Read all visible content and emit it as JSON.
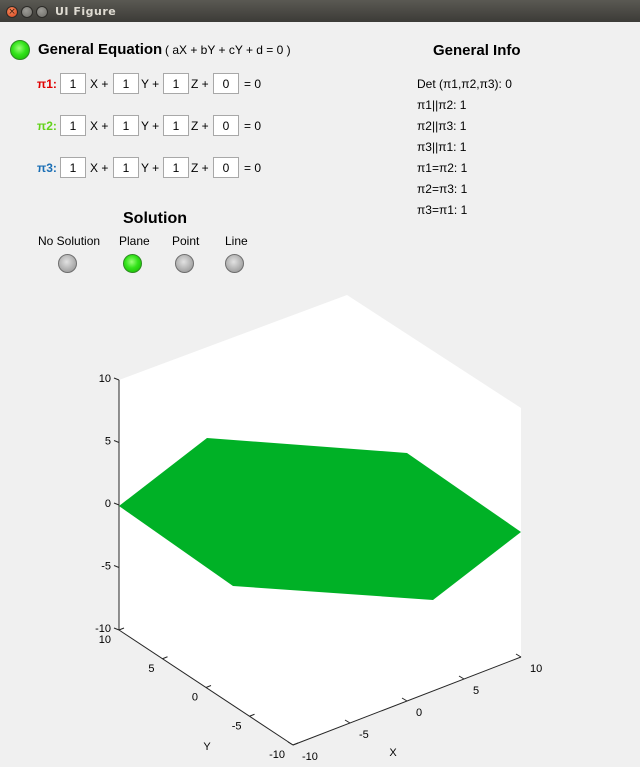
{
  "window": {
    "title": "UI Figure"
  },
  "equation": {
    "heading": "General Equation",
    "form": "( aX + bY + cY + d = 0 )",
    "rows": [
      {
        "label": "π1:",
        "color": "#e00000",
        "a": "1",
        "b": "1",
        "c": "1",
        "d": "0"
      },
      {
        "label": "π2:",
        "color": "#63d21b",
        "a": "1",
        "b": "1",
        "c": "1",
        "d": "0"
      },
      {
        "label": "π3:",
        "color": "#1b6fb5",
        "a": "1",
        "b": "1",
        "c": "1",
        "d": "0"
      }
    ],
    "terms": {
      "x": "X +",
      "y": "Y +",
      "z": "Z +",
      "eq": "= 0"
    }
  },
  "solution": {
    "heading": "Solution",
    "lamps": [
      {
        "label": "No Solution",
        "on": false
      },
      {
        "label": "Plane",
        "on": true
      },
      {
        "label": "Point",
        "on": false
      },
      {
        "label": "Line",
        "on": false
      }
    ]
  },
  "info": {
    "heading": "General Info",
    "lines": [
      "Det (π1,π2,π3):  0",
      "π1||π2: 1",
      "π2||π3: 1",
      "π3||π1: 1",
      "π1=π2: 1",
      "π2=π3: 1",
      "π3=π1: 1"
    ]
  },
  "chart_data": {
    "type": "surface3d",
    "xlabel": "X",
    "ylabel": "Y",
    "zlabel": "",
    "xlim": [
      -10,
      10
    ],
    "ylim": [
      -10,
      10
    ],
    "zlim": [
      -10,
      10
    ],
    "x_ticks": [
      "-10",
      "-5",
      "0",
      "5",
      "10"
    ],
    "y_ticks": [
      "-10",
      "-5",
      "0",
      "5",
      "10"
    ],
    "z_ticks": [
      "10",
      "5",
      "0",
      "-5",
      "-10"
    ],
    "surface": {
      "equation": "x + y + z = 0",
      "color": "#00b126"
    }
  }
}
